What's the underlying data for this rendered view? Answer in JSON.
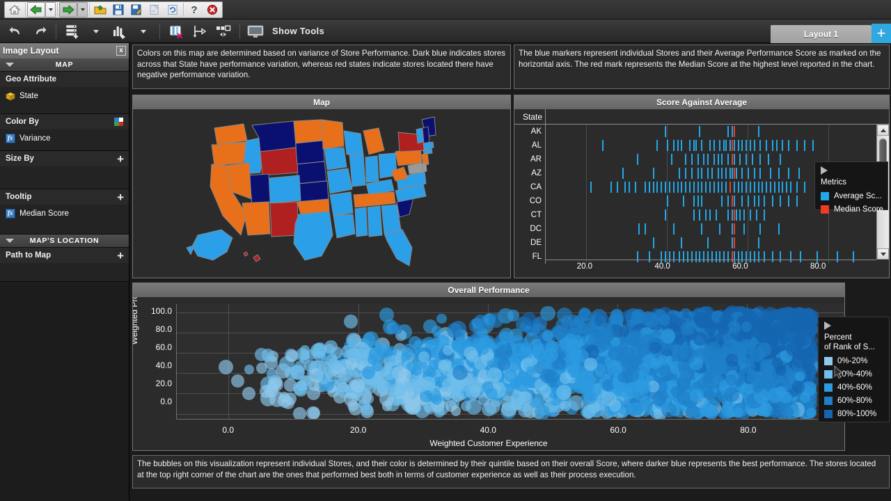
{
  "browser_toolbar": {
    "buttons": [
      {
        "name": "home-icon",
        "title": "Home"
      },
      {
        "name": "back-arrow-icon",
        "title": "Back"
      },
      {
        "name": "back-dropdown-icon",
        "title": "Back history"
      },
      {
        "name": "forward-arrow-icon",
        "title": "Forward"
      },
      {
        "name": "forward-dropdown-icon",
        "title": "Forward history"
      },
      {
        "name": "open-folder-icon",
        "title": "Open"
      },
      {
        "name": "save-icon",
        "title": "Save"
      },
      {
        "name": "save-as-icon",
        "title": "Save As"
      },
      {
        "name": "export-icon",
        "title": "Export"
      },
      {
        "name": "refresh-icon",
        "title": "Refresh"
      },
      {
        "name": "help-icon",
        "title": "Help"
      },
      {
        "name": "close-icon",
        "title": "Close"
      }
    ]
  },
  "app_toolbar": {
    "undo_title": "Undo",
    "redo_title": "Redo",
    "data-title": "Add Data",
    "chart_title": "Add Chart",
    "delete_col_title": "Delete Column",
    "branch_title": "Branch",
    "resize_title": "Resize",
    "show_tools_label": "Show Tools",
    "monitor_title": "Display"
  },
  "tabs": {
    "items": [
      {
        "label": "Layout 1",
        "active": true
      }
    ],
    "add_label": "+"
  },
  "sidebar": {
    "title": "Image Layout",
    "close_label": "x",
    "sections": [
      {
        "name": "map",
        "header": "MAP",
        "fields": [
          {
            "label": "Geo Attribute",
            "plus": false,
            "items": [
              {
                "label": "State",
                "icon": "cube-icon"
              }
            ]
          },
          {
            "label": "Color By",
            "plus": false,
            "palette": true,
            "items": [
              {
                "label": "Variance",
                "icon": "fx-icon"
              }
            ]
          },
          {
            "label": "Size By",
            "plus": true,
            "items": []
          },
          {
            "label": "Tooltip",
            "plus": true,
            "items": [
              {
                "label": "Median Score",
                "icon": "fx-icon"
              }
            ]
          }
        ]
      },
      {
        "name": "maps-location",
        "header": "MAP'S LOCATION",
        "fields": [
          {
            "label": "Path to Map",
            "plus": true,
            "items": []
          }
        ]
      }
    ]
  },
  "descriptions": {
    "map_desc": "Colors on this map are determined based on variance of Store Performance. Dark blue indicates stores across that State have performance variation, whereas red states indicate stores located there have negative performance variation.",
    "score_desc": "The blue markers represent individual Stores and their Average Performance Score as marked on the horizontal axis. The red mark represents the Median Score at the highest level reported in the chart.",
    "scatter_desc": "The bubbles on this visualization represent individual Stores, and their color is determined by their quintile based on their overall Score, where darker blue represents the best performance. The stores located at the top right corner of the chart are the ones that performed best both in terms of customer experience as well as their process execution."
  },
  "panels": {
    "map_title": "Map",
    "score_title": "Score Against Average",
    "scatter_title": "Overall Performance"
  },
  "colors": {
    "map_orange": "#E8701A",
    "map_lightblue": "#2B9FE8",
    "map_navy": "#0A1070",
    "map_darkred": "#B02020",
    "map_grey": "#9a9a9a",
    "accent_blue": "#22A7E8",
    "median_red": "#EF3B20",
    "tab_add_bg": "#2FA8E0"
  },
  "metrics_legend": {
    "title": "Metrics",
    "items": [
      {
        "label": "Average Sc...",
        "color": "#22A7E8"
      },
      {
        "label": "Median Score",
        "color": "#EF3B20"
      }
    ]
  },
  "quintile_legend": {
    "title_line1": "Percent",
    "title_line2": "of Rank of S...",
    "items": [
      {
        "label": "0%-20%",
        "color": "#8FC9EC"
      },
      {
        "label": "20%-40%",
        "color": "#6FBDEB"
      },
      {
        "label": "40%-60%",
        "color": "#2C9BE0"
      },
      {
        "label": "60%-80%",
        "color": "#1F7FC8"
      },
      {
        "label": "80%-100%",
        "color": "#1565B0"
      }
    ]
  },
  "chart_data": [
    {
      "type": "scatter",
      "name": "score-against-average",
      "title": "Score Against Average",
      "xlabel": "",
      "ylabel": "State",
      "row_header": "State",
      "xlim": [
        10,
        95
      ],
      "xticks": [
        20.0,
        40.0,
        60.0,
        80.0
      ],
      "xticklabels": [
        "20.0",
        "40.0",
        "60.0",
        "80.0"
      ],
      "grid": true,
      "legend_position": "right",
      "categories": [
        "AK",
        "AL",
        "AR",
        "AZ",
        "CA",
        "CO",
        "CT",
        "DC",
        "DE",
        "FL"
      ],
      "series": [
        {
          "name": "Average Score",
          "color": "#22A7E8"
        },
        {
          "name": "Median Score",
          "color": "#EF3B20"
        }
      ],
      "rows": [
        {
          "state": "AK",
          "median": 56.5,
          "values": [
            39.5,
            48.0,
            55.0,
            56.0,
            62.5
          ]
        },
        {
          "state": "AL",
          "median": 56.0,
          "values": [
            24.0,
            37.5,
            40.0,
            41.5,
            42.5,
            43.5,
            45.5,
            46.5,
            47.0,
            48.5,
            50.5,
            51.5,
            53.0,
            54.0,
            54.5,
            55.5,
            56.5,
            57.5,
            58.5,
            59.5,
            60.5,
            61.5,
            63.0,
            64.5,
            66.0,
            67.0,
            68.5,
            70.0,
            72.0,
            74.0,
            76.0
          ]
        },
        {
          "state": "AR",
          "median": 56.0,
          "values": [
            32.5,
            41.0,
            44.5,
            46.0,
            47.5,
            49.0,
            50.0,
            51.5,
            52.5,
            53.5,
            55.0,
            56.5,
            58.0,
            59.5,
            61.0,
            63.0,
            65.0,
            68.0
          ]
        },
        {
          "state": "AZ",
          "median": 56.5,
          "values": [
            29.0,
            36.5,
            43.0,
            44.5,
            46.0,
            47.5,
            48.5,
            50.0,
            51.0,
            52.5,
            53.5,
            54.5,
            55.5,
            56.0,
            57.0,
            58.5,
            60.0,
            61.5,
            63.0,
            65.5,
            67.5,
            70.0,
            72.5
          ]
        },
        {
          "state": "CA",
          "median": 55.5,
          "values": [
            21.0,
            26.0,
            27.5,
            29.5,
            30.5,
            32.0,
            34.5,
            35.5,
            36.5,
            37.5,
            38.5,
            39.5,
            40.5,
            41.5,
            42.5,
            43.5,
            44.5,
            45.5,
            46.5,
            47.5,
            48.5,
            49.5,
            50.5,
            51.5,
            52.5,
            53.5,
            54.5,
            55.5,
            56.5,
            57.5,
            58.5,
            59.5,
            60.5,
            61.5,
            62.5,
            63.5,
            64.5,
            65.5,
            66.5,
            67.5,
            68.5,
            69.5,
            70.5,
            72.0,
            74.0,
            76.5,
            79.0,
            82.0
          ]
        },
        {
          "state": "CO",
          "median": 56.0,
          "values": [
            40.0,
            44.0,
            46.5,
            47.5,
            48.5,
            53.5,
            55.0,
            56.5,
            58.5,
            60.0,
            61.5,
            62.5,
            64.0,
            66.0,
            68.0,
            70.0,
            72.0
          ]
        },
        {
          "state": "CT",
          "median": 56.5,
          "values": [
            39.5,
            46.5,
            48.0,
            49.5,
            50.5,
            52.0,
            55.0,
            56.0,
            57.0,
            58.0,
            59.0,
            60.5,
            62.0,
            64.0
          ]
        },
        {
          "state": "DC",
          "median": 56.5,
          "values": [
            33.0,
            34.5,
            41.5,
            48.5,
            53.0,
            56.0,
            59.0,
            63.0,
            67.5
          ]
        },
        {
          "state": "DE",
          "median": 56.5,
          "values": [
            36.5,
            43.5,
            50.0,
            56.0,
            62.5
          ]
        },
        {
          "state": "FL",
          "median": 56.0,
          "values": [
            32.5,
            35.5,
            38.5,
            39.5,
            40.5,
            41.5,
            43.0,
            44.0,
            45.0,
            46.0,
            47.0,
            48.0,
            49.0,
            50.0,
            51.0,
            52.0,
            53.0,
            54.0,
            55.0,
            56.5,
            57.5,
            58.5,
            59.5,
            60.5,
            61.5,
            62.5,
            64.0,
            66.0,
            68.0,
            70.5,
            73.0,
            77.0,
            82.0,
            86.0
          ]
        }
      ]
    },
    {
      "type": "scatter",
      "name": "overall-performance",
      "title": "Overall Performance",
      "xlabel": "Weighted Customer Experience",
      "ylabel": "Weighted Process",
      "xlim": [
        -8,
        95
      ],
      "ylim": [
        -5,
        108
      ],
      "xticks": [
        0.0,
        20.0,
        40.0,
        60.0,
        80.0
      ],
      "xticklabels": [
        "0.0",
        "20.0",
        "40.0",
        "60.0",
        "80.0"
      ],
      "yticks": [
        0.0,
        20.0,
        40.0,
        60.0,
        80.0,
        100.0
      ],
      "yticklabels": [
        "0.0",
        "20.0",
        "40.0",
        "60.0",
        "80.0",
        "100.0"
      ],
      "grid": true,
      "legend_position": "right",
      "legend_title": "Percent of Rank of S...",
      "marker": "bubble",
      "series": [
        {
          "name": "0%-20%",
          "color": "#8FC9EC"
        },
        {
          "name": "20%-40%",
          "color": "#6FBDEB"
        },
        {
          "name": "40%-60%",
          "color": "#2C9BE0"
        },
        {
          "name": "60%-80%",
          "color": "#1F7FC8"
        },
        {
          "name": "80%-100%",
          "color": "#1565B0"
        }
      ],
      "note": "Dense cloud of ~3000 overlapping semi-transparent bubbles; density and darkness both increase to the right.",
      "point_count": 3000
    }
  ]
}
